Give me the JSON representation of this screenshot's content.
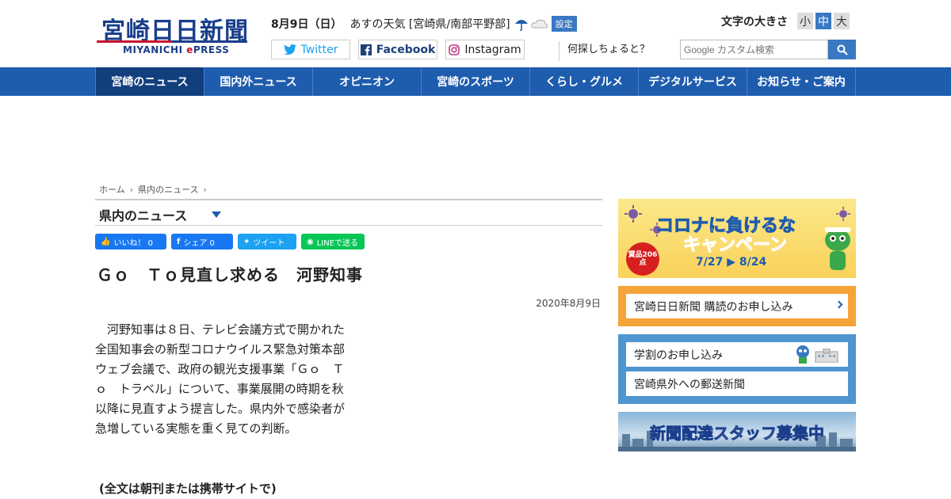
{
  "header": {
    "logo_main": "宮崎日日新聞",
    "logo_sub_a": "MIYANICHI ",
    "logo_sub_e": "e",
    "logo_sub_b": "PRESS",
    "date": "8月9日（日）",
    "weather": "あすの天気 [宮崎県/南部平野部]",
    "settings_label": "設定",
    "social": {
      "twitter": "Twitter",
      "facebook": "Facebook",
      "instagram": "Instagram"
    },
    "ask_link": "何探しちょると？",
    "font_size_label": "文字の大きさ",
    "font_small": "小",
    "font_mid": "中",
    "font_large": "大",
    "search_placeholder": "Google カスタム検索"
  },
  "nav": {
    "items": [
      "宮崎のニュース",
      "国内外ニュース",
      "オピニオン",
      "宮崎のスポーツ",
      "くらし・グルメ",
      "デジタルサービス",
      "お知らせ・ご案内"
    ]
  },
  "breadcrumb": {
    "home": "ホーム",
    "section": "県内のニュース"
  },
  "section_title": "県内のニュース",
  "share": {
    "like": "いいね！ 0",
    "share": "シェア 0",
    "tweet": "ツイート",
    "line": "LINEで送る"
  },
  "article": {
    "headline": "Ｇｏ　Ｔｏ見直し求める　河野知事",
    "date": "2020年8月9日",
    "body": "河野知事は８日、テレビ会議方式で開かれた全国知事会の新型コロナウイルス緊急対策本部ウェブ会議で、政府の観光支援事業「Ｇｏ　Ｔｏ　トラベル」について、事業展開の時期を秋以降に見直すよう提言した。県内外で感染者が急増している実態を重く見ての判断。",
    "fulltext": "(全文は朝刊または携帯サイトで)"
  },
  "sidebar": {
    "corona_title": "コロナに負けるな",
    "corona_sub": "キャンペーン",
    "corona_date": "7/27 ▶ 8/24",
    "corona_badge": "賞品206点",
    "subscribe": "宮崎日日新聞 購読のお申し込み",
    "student": "学割のお申し込み",
    "mail": "宮崎県外への郵送新聞",
    "staff": "新聞配達スタッフ募集中"
  },
  "colors": {
    "brand_blue": "#1e5cae",
    "nav_active": "#123e7e",
    "orange": "#f5a43a",
    "light_blue": "#4f95d0"
  }
}
